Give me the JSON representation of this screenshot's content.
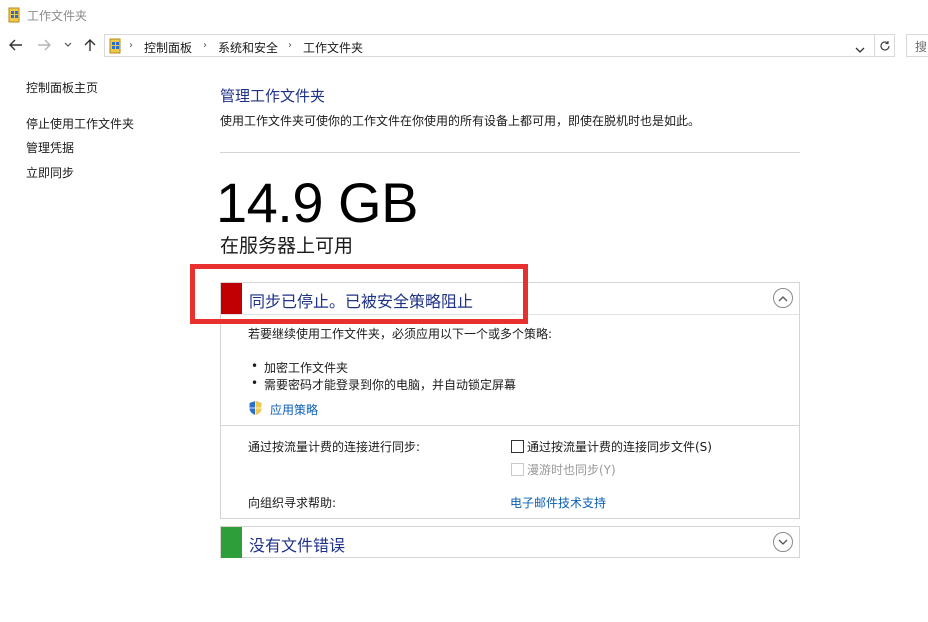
{
  "window": {
    "title": "工作文件夹"
  },
  "address": {
    "breadcrumbs": [
      "控制面板",
      "系统和安全",
      "工作文件夹"
    ],
    "search_placeholder": "搜"
  },
  "sidebar": {
    "items": [
      {
        "label": "控制面板主页"
      },
      {
        "label": "停止使用工作文件夹"
      },
      {
        "label": "管理凭据"
      },
      {
        "label": "立即同步"
      }
    ]
  },
  "main": {
    "title": "管理工作文件夹",
    "description": "使用工作文件夹可使你的工作文件在你使用的所有设备上都可用，即使在脱机时也是如此。",
    "space_value": "14.9 GB",
    "space_caption": "在服务器上可用"
  },
  "sync_panel": {
    "status_color": "#c00000",
    "title": "同步已停止。已被安全策略阻止",
    "intro": "若要继续使用工作文件夹，必须应用以下一个或多个策略:",
    "policies": [
      "加密工作文件夹",
      "需要密码才能登录到你的电脑，并自动锁定屏幕"
    ],
    "apply_label": "应用策略",
    "metered_label": "通过按流量计费的连接进行同步:",
    "metered_option": "通过按流量计费的连接同步文件(S)",
    "roaming_option": "漫游时也同步(Y)",
    "help_label": "向组织寻求帮助:",
    "help_link": "电子邮件技术支持"
  },
  "error_panel": {
    "status_color": "#2e9e3a",
    "title": "没有文件错误"
  }
}
